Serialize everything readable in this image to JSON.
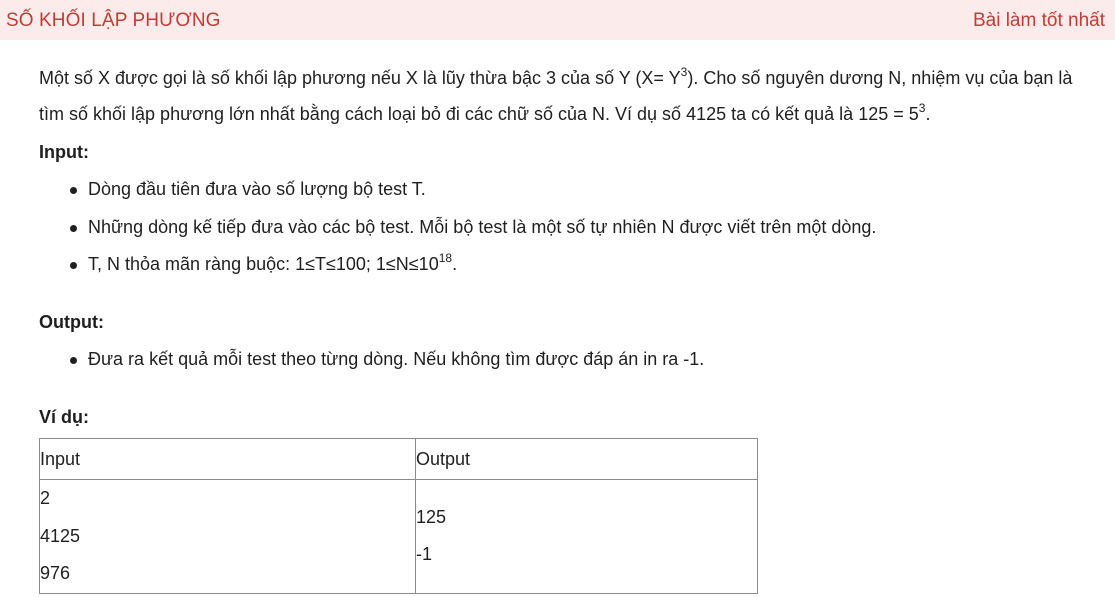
{
  "header": {
    "title": "SỐ KHỐI LẬP PHƯƠNG",
    "best_solution_link": "Bài làm tốt nhất"
  },
  "statement": {
    "line1_a": "Một số X được gọi là số khối lập phương nếu X là lũy thừa bậc 3 của số Y (X= Y",
    "line1_sup": "3",
    "line1_b": "). Cho số nguyên dương N, nhiệm vụ của bạn là",
    "line2_a": "tìm số khối lập phương lớn nhất bằng cách loại bỏ đi các chữ số của N. Ví dụ số 4125 ta có kết quả là 125 = 5",
    "line2_sup": "3",
    "line2_b": "."
  },
  "input_section": {
    "heading": "Input:",
    "items": [
      {
        "text": "Dòng đầu tiên đưa vào số lượng bộ test T."
      },
      {
        "text": "Những dòng kế tiếp đưa vào các bộ test. Mỗi bộ test là một số tự nhiên N được viết trên một dòng."
      },
      {
        "text_a": "T, N thỏa mãn ràng buộc: 1≤T≤100;  1≤N≤10",
        "sup": "18",
        "text_b": "."
      }
    ]
  },
  "output_section": {
    "heading": "Output:",
    "items": [
      {
        "text": "Đưa ra kết quả mỗi test theo từng dòng. Nếu không tìm được đáp án in ra -1."
      }
    ]
  },
  "example": {
    "heading": "Ví dụ:",
    "columns": [
      "Input",
      "Output"
    ],
    "input_lines": [
      "2",
      "4125",
      "976"
    ],
    "output_lines": [
      "125",
      "-1"
    ]
  }
}
